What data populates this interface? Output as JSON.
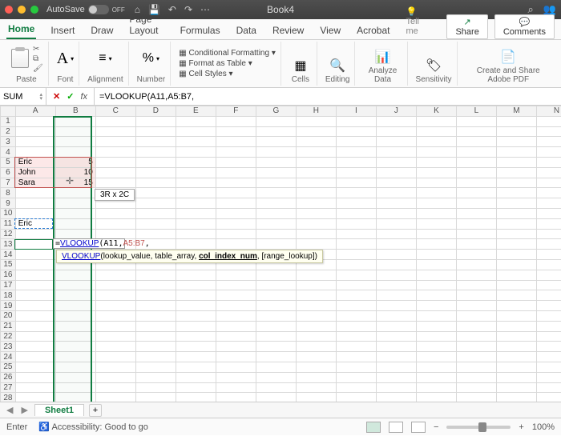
{
  "titlebar": {
    "autosave_label": "AutoSave",
    "autosave_state": "OFF",
    "doc_title": "Book4"
  },
  "tabs": {
    "items": [
      "Home",
      "Insert",
      "Draw",
      "Page Layout",
      "Formulas",
      "Data",
      "Review",
      "View",
      "Acrobat"
    ],
    "tell_me": "Tell me",
    "share": "Share",
    "comments": "Comments"
  },
  "ribbon": {
    "paste": "Paste",
    "font": "Font",
    "alignment": "Alignment",
    "number": "Number",
    "cond_fmt": "Conditional Formatting",
    "fmt_table": "Format as Table",
    "cell_styles": "Cell Styles",
    "cells": "Cells",
    "editing": "Editing",
    "analyze": "Analyze Data",
    "sensitivity": "Sensitivity",
    "pdf": "Create and Share Adobe PDF"
  },
  "fxbar": {
    "namebox": "SUM",
    "formula": "=VLOOKUP(A11,A5:B7,"
  },
  "grid": {
    "columns": [
      "A",
      "B",
      "C",
      "D",
      "E",
      "F",
      "G",
      "H",
      "I",
      "J",
      "K",
      "L",
      "M",
      "N"
    ],
    "rows": 31,
    "data": {
      "A5": "Eric",
      "B5": "5",
      "A6": "John",
      "B6": "10",
      "A7": "Sara",
      "B7": "15",
      "A11": "Eric"
    },
    "size_tip": "3R x 2C",
    "cell_formula": "=VLOOKUP(A11,A5:B7,",
    "hint_fn": "VLOOKUP",
    "hint_sig": [
      "lookup_value",
      "table_array"
    ],
    "hint_bold": "col_index_num",
    "hint_tail": "[range_lookup]"
  },
  "sheets": {
    "active": "Sheet1"
  },
  "status": {
    "mode": "Enter",
    "accessibility": "Accessibility: Good to go",
    "zoom": "100%"
  }
}
